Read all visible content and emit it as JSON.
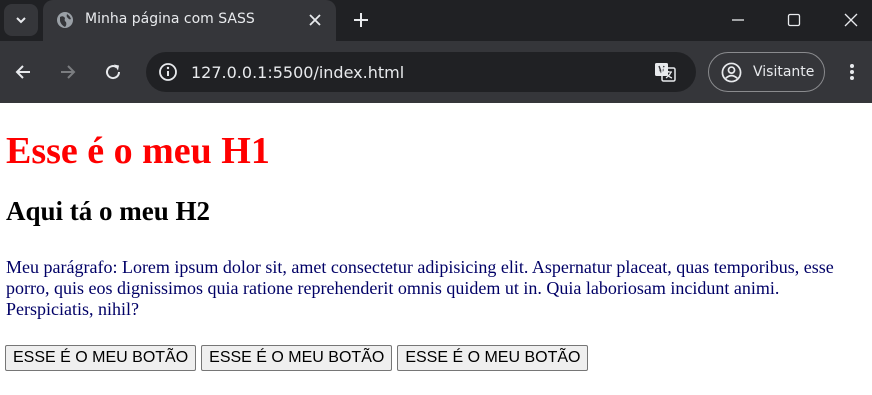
{
  "browser": {
    "tab_title": "Minha página com SASS",
    "url": "127.0.0.1:5500/index.html",
    "profile_label": "Visitante"
  },
  "page": {
    "h1": "Esse é o meu H1",
    "h2": "Aqui tá o meu H2",
    "paragraph": "Meu parágrafo: Lorem ipsum dolor sit, amet consectetur adipisicing elit. Aspernatur placeat, quas temporibus, esse porro, quis eos dignissimos quia ratione reprehenderit omnis quidem ut in. Quia laboriosam incidunt animi. Perspiciatis, nihil?",
    "buttons": [
      "ESSE É O MEU BOTÃO",
      "ESSE É O MEU BOTÃO",
      "ESSE É O MEU BOTÃO"
    ]
  },
  "colors": {
    "h1": "#ff0000",
    "paragraph": "#000066",
    "chrome_dark": "#202124",
    "chrome_toolbar": "#35363a"
  },
  "icons": {
    "tab_search": "chevron-down-icon",
    "favicon": "globe-icon",
    "tab_close": "close-icon",
    "new_tab": "plus-icon",
    "minimize": "minimize-icon",
    "maximize": "maximize-icon",
    "window_close": "close-icon",
    "back": "arrow-left-icon",
    "forward": "arrow-right-icon",
    "reload": "reload-icon",
    "site_info": "info-icon",
    "translate": "translate-icon",
    "profile": "account-icon",
    "menu": "more-vert-icon"
  }
}
